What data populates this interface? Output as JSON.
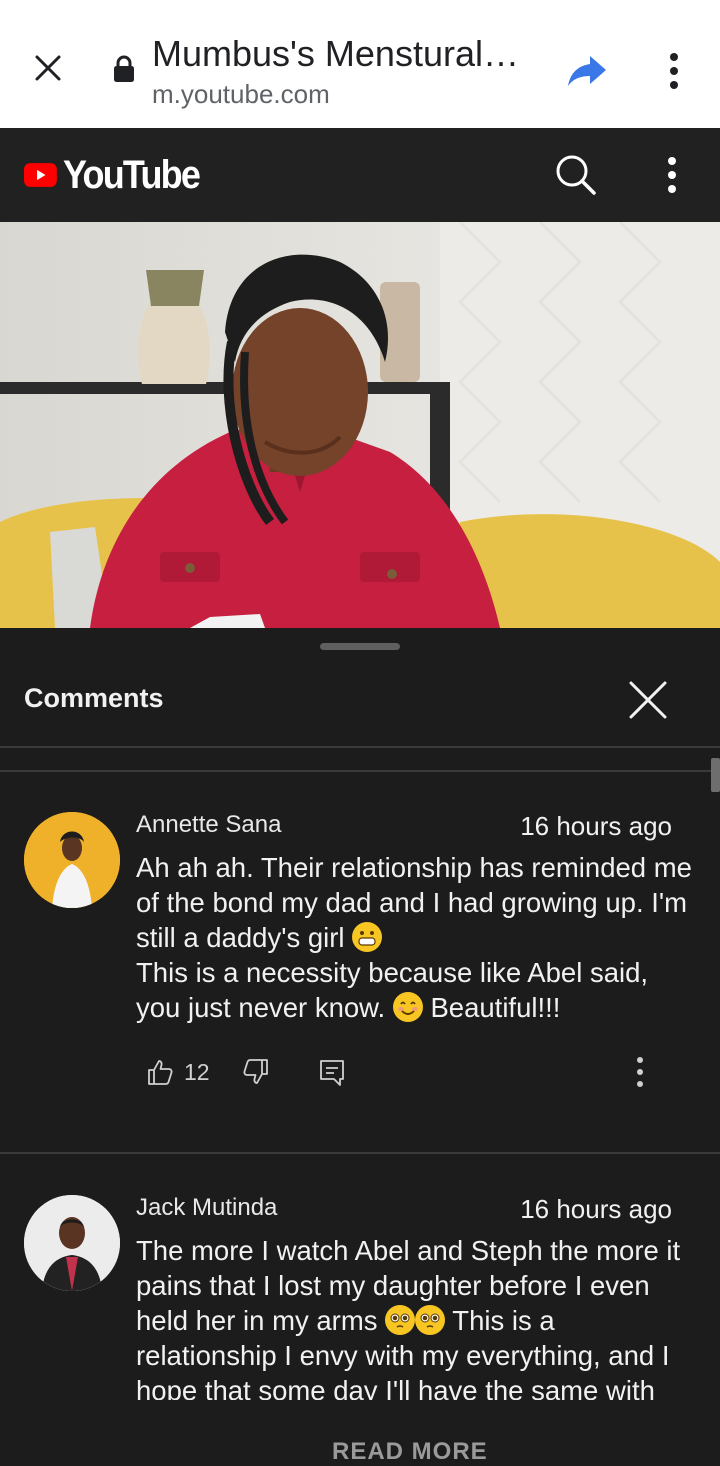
{
  "browser": {
    "title": "Mumbus's Menstural…",
    "url": "m.youtube.com",
    "close_icon": "close-icon",
    "lock_icon": "lock-icon",
    "share_icon": "share-icon",
    "menu_icon": "more-vert-icon",
    "share_color": "#3b78e7"
  },
  "youtube": {
    "logo_text": "YouTube",
    "logo_color": "#ff0000",
    "search_icon": "search-icon",
    "menu_icon": "more-vert-icon"
  },
  "comments_panel": {
    "title": "Comments",
    "close_icon": "close-icon",
    "comments": [
      {
        "author": "Annette Sana",
        "time": "16 hours ago",
        "lines": [
          "Ah ah ah. Their relationship has reminded me of the bond my dad and I had growing up. I'm still a daddy's girl",
          "This is a necessity because like Abel said, you just never know.",
          "Beautiful!!!"
        ],
        "likes": "12"
      },
      {
        "author": "Jack Mutinda",
        "time": "16 hours ago",
        "lines": [
          "The more I watch Abel and Steph the more it pains that I lost my daughter before I even held her in my arms",
          "This is a relationship I envy with my everything, and I hope that some day I'll have the same with"
        ]
      }
    ],
    "read_more": "READ MORE"
  }
}
